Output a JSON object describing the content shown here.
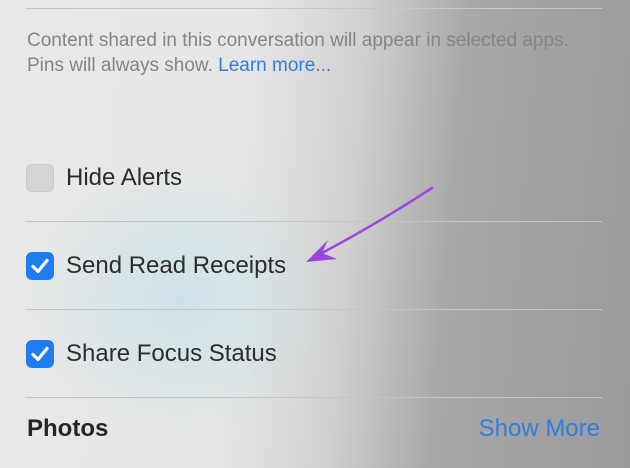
{
  "info": {
    "description": "Content shared in this conversation will appear in selected apps. Pins will always show.",
    "learn_more": "Learn more..."
  },
  "options": [
    {
      "label": "Hide Alerts",
      "checked": false
    },
    {
      "label": "Send Read Receipts",
      "checked": true
    },
    {
      "label": "Share Focus Status",
      "checked": true
    }
  ],
  "photos": {
    "title": "Photos",
    "show_more": "Show More"
  },
  "colors": {
    "accent": "#1f7cf2",
    "link": "#2f7de1",
    "annotation_arrow": "#9a45e0"
  },
  "icons": {
    "check": "checkmark-icon",
    "annotation": "arrow-annotation"
  }
}
